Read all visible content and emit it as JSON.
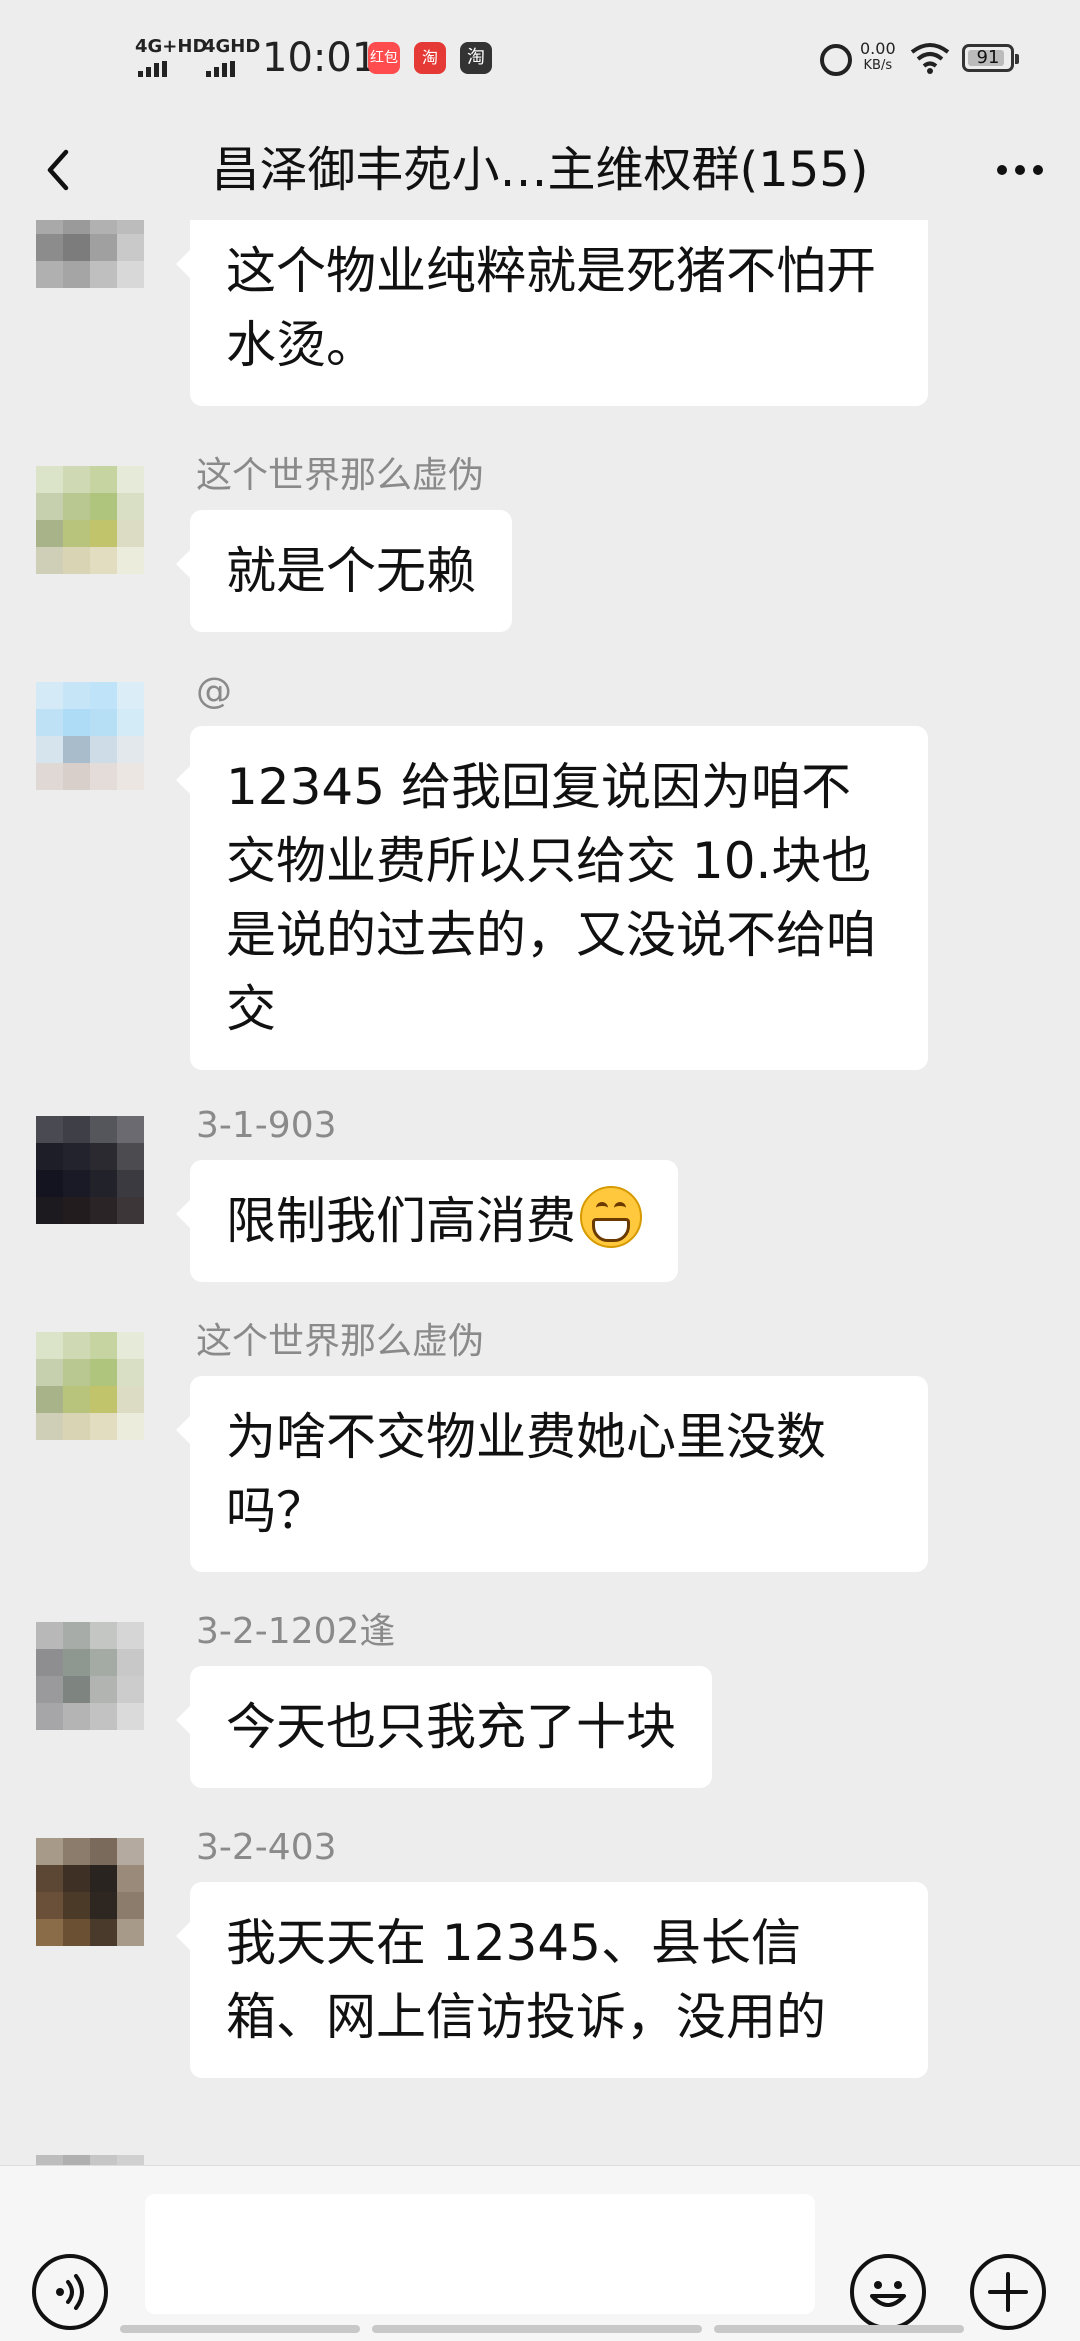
{
  "status_bar": {
    "network_1": "4G+HD",
    "network_2": "4GHD",
    "time": "10:01",
    "app_icon_1": "红包",
    "app_icon_2": "淘",
    "app_icon_3": "淘",
    "speed_value": "0.00",
    "speed_unit": "KB/s",
    "battery": "91",
    "battery_level": 0.91
  },
  "header": {
    "title": "昌泽御丰苑小…主维权群(155)",
    "back_icon": "chevron-left-icon",
    "more_icon": "more-dots-icon"
  },
  "messages": [
    {
      "sender": "",
      "text": "这个物业纯粹就是死猪不怕开水烫。"
    },
    {
      "sender": "这个世界那么虚伪",
      "text": "就是个无赖"
    },
    {
      "sender": "@",
      "text": "12345 给我回复说因为咱不交物业费所以只给交 10.块也是说的过去的，又没说不给咱交"
    },
    {
      "sender": "3-1-903",
      "text": "限制我们高消费",
      "emoji": "grinning-face-icon"
    },
    {
      "sender": "这个世界那么虚伪",
      "text": "为啥不交物业费她心里没数吗？"
    },
    {
      "sender": "3-2-1202逢",
      "text": "今天也只我充了十块"
    },
    {
      "sender": "3-2-403",
      "text": "我天天在 12345、县长信箱、网上信访投诉，没用的"
    }
  ],
  "input_bar": {
    "voice_icon": "voice-icon",
    "emoji_icon": "emoji-icon",
    "plus_icon": "plus-icon",
    "input_value": ""
  },
  "colors": {
    "background": "#ededed",
    "bubble": "#ffffff",
    "sender_name": "#8a8a8a"
  }
}
